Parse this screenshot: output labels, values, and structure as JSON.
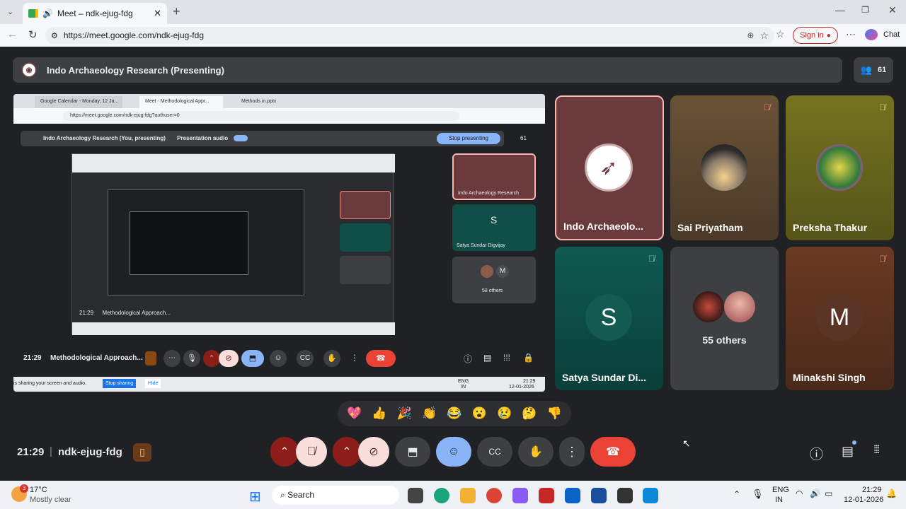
{
  "browser": {
    "tab_title": "Meet – ndk-ejug-fdg",
    "url": "https://meet.google.com/ndk-ejug-fdg",
    "signin_label": "Sign in",
    "chat_label": "Chat"
  },
  "meet": {
    "presenter_banner": "Indo Archaeology Research (Presenting)",
    "participant_count": "61",
    "time": "21:29",
    "meeting_code": "ndk-ejug-fdg",
    "tiles": [
      {
        "name": "Indo Archaeolo...",
        "color": "#6b3a3d"
      },
      {
        "name": "Sai Priyatham",
        "color": "#5a4530"
      },
      {
        "name": "Preksha Thakur",
        "color": "#6a6a20"
      },
      {
        "name": "Satya Sundar Di...",
        "avatar": "S",
        "color": "#0f4f48"
      },
      {
        "name": "55 others",
        "color": "#3c4043"
      },
      {
        "name": "Minakshi Singh",
        "avatar": "M",
        "color": "#5a3020"
      }
    ],
    "emojis": [
      "💖",
      "👍",
      "🎉",
      "👏",
      "😂",
      "😮",
      "😢",
      "🤔",
      "👎"
    ]
  },
  "share": {
    "inner_tabs": [
      "Google Calendar - Monday, 12 Ja...",
      "Meet - Methodological Appr...",
      "Methods in.pptx"
    ],
    "inner_url": "https://meet.google.com/ndk-ejug-fdg?authuser=0",
    "inner_banner": "Indo Archaeology Research (You, presenting)",
    "presentation_audio": "Presentation audio",
    "stop_presenting": "Stop presenting",
    "inner_count": "61",
    "inner_tiles": [
      "Indo Archaeology Research",
      "Satya Sundar Digvijay",
      "58 others"
    ],
    "inner_avatars": [
      "S",
      "M"
    ],
    "inner_time": "21:29",
    "inner_meeting": "Methodological Approach...",
    "share_notice": "is sharing your screen and audio.",
    "stop_sharing": "Stop sharing",
    "hide": "Hide",
    "inner_clock": "21:29",
    "inner_date": "12-01-2026",
    "inner_lang": "ENG",
    "inner_region": "IN"
  },
  "taskbar": {
    "weather_temp": "17°C",
    "weather_desc": "Mostly clear",
    "weather_badge": "3",
    "search_label": "Search",
    "lang": "ENG",
    "region": "IN",
    "clock": "21:29",
    "date": "12-01-2026"
  }
}
